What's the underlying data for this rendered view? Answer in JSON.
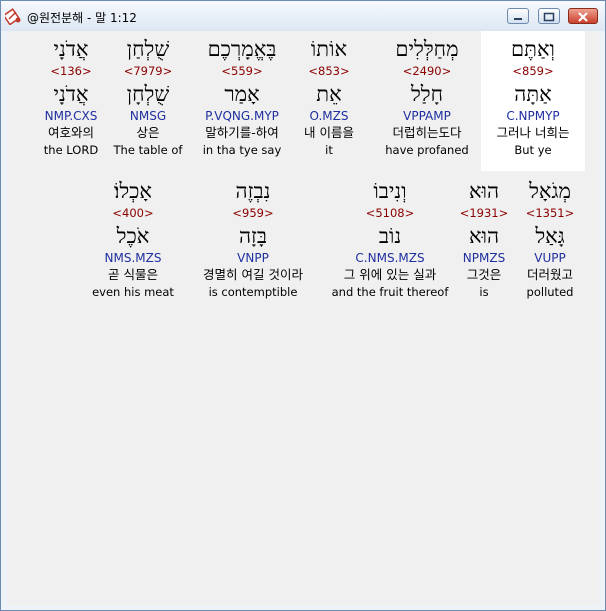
{
  "window": {
    "title": "@원전분해 - 말 1:12",
    "controls": {
      "minimize": "minimize",
      "maximize": "maximize",
      "close": "close"
    }
  },
  "icons": {
    "app": "bible-app-icon"
  },
  "colors": {
    "strong_number": "#8b0000",
    "morphology": "#1f2fa0",
    "selected_bg": "#ffffff"
  },
  "rows": [
    {
      "words": [
        {
          "hebrew": "וְאַתֶּם",
          "strong": "<859>",
          "lemma": "אַתָּה",
          "morph": "C.NPMYP",
          "korean": "그러나 너희는",
          "english": "But ye",
          "selected": true
        },
        {
          "hebrew": "מְחַלְּלִים",
          "strong": "<2490>",
          "lemma": "חָלַל",
          "morph": "VPPAMP",
          "korean": "더럽히는도다",
          "english": "have profaned",
          "selected": false
        },
        {
          "hebrew": "אוֹתוֹ",
          "strong": "<853>",
          "lemma": "אֵת",
          "morph": "O.MZS",
          "korean": "내 이름을",
          "english": "it",
          "selected": false
        },
        {
          "hebrew": "בֶּאֱמָרְכֶם",
          "strong": "<559>",
          "lemma": "אָמַר",
          "morph": "P.VQNG.MYP",
          "korean": "말하기를-하여",
          "english": "in tha tye say",
          "selected": false
        },
        {
          "hebrew": "שֻׁלְחַן",
          "strong": "<7979>",
          "lemma": "שֻׁלְחָן",
          "morph": "NMSG",
          "korean": "상은",
          "english": "The table of",
          "selected": false
        },
        {
          "hebrew": "אֲדֹנָי",
          "strong": "<136>",
          "lemma": "אֲדֹנָי",
          "morph": "NMP.CXS",
          "korean": "여호와의",
          "english": "the LORD",
          "selected": false
        }
      ]
    },
    {
      "words": [
        {
          "hebrew": "מְגֹאָל",
          "strong": "<1351>",
          "lemma": "גָּאַל",
          "morph": "VUPP",
          "korean": "더러웠고",
          "english": "polluted",
          "selected": false
        },
        {
          "hebrew": "הוּא",
          "strong": "<1931>",
          "lemma": "הוּא",
          "morph": "NPMZS",
          "korean": "그것은",
          "english": "is",
          "selected": false
        },
        {
          "hebrew": "וְנִיבוֹ",
          "strong": "<5108>",
          "lemma": "נוֹב",
          "morph": "C.NMS.MZS",
          "korean": "그 위에 있는 실과",
          "english": "and the fruit thereof",
          "selected": false
        },
        {
          "hebrew": "נִבְזֶה",
          "strong": "<959>",
          "lemma": "בָּזָה",
          "morph": "VNPP",
          "korean": "경멸히 여길 것이라",
          "english": "is contemptible",
          "selected": false
        },
        {
          "hebrew": "אָכְלוֹ׃",
          "strong": "<400>",
          "lemma": "אֹכֶל",
          "morph": "NMS.MZS",
          "korean": "곧 식물은",
          "english": "even his meat",
          "selected": false
        }
      ]
    }
  ]
}
